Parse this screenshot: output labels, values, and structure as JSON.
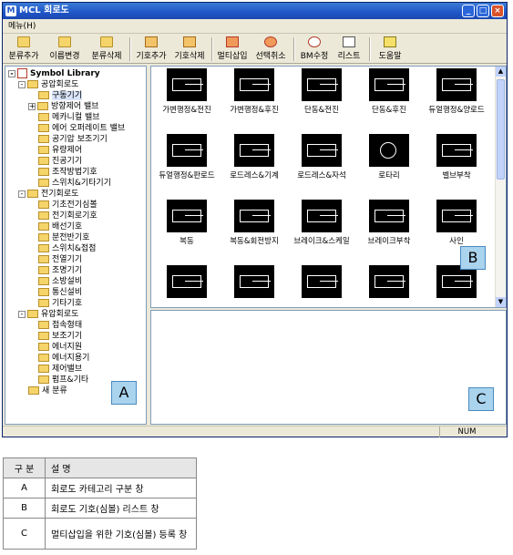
{
  "window": {
    "title": "MCL 회로도",
    "app_icon": "M",
    "controls": [
      "_",
      "□",
      "×"
    ]
  },
  "menu": {
    "label": "메뉴(H)"
  },
  "toolbar": {
    "buttons": [
      {
        "label": "분류추가",
        "icon": "folder-add-icon"
      },
      {
        "label": "이름변경",
        "icon": "folder-rename-icon"
      },
      {
        "label": "분류삭제",
        "icon": "folder-delete-icon"
      },
      {
        "label": "기호추가",
        "icon": "symbol-add-icon"
      },
      {
        "label": "기호삭제",
        "icon": "symbol-delete-icon"
      },
      {
        "label": "멀티삽입",
        "icon": "multi-insert-icon"
      },
      {
        "label": "선택취소",
        "icon": "cancel-selection-icon"
      },
      {
        "label": "BM수정",
        "icon": "bm-edit-icon"
      },
      {
        "label": "리스트",
        "icon": "list-icon"
      },
      {
        "label": "도움말",
        "icon": "help-icon"
      }
    ]
  },
  "tree": {
    "root": "Symbol Library",
    "items": [
      {
        "label": "공압회로도",
        "level": 1,
        "expander": "-"
      },
      {
        "label": "구동기기",
        "level": 2,
        "selected": true
      },
      {
        "label": "방향제어 밸브",
        "level": 2,
        "expander": "+"
      },
      {
        "label": "메카니컬 밸브",
        "level": 2
      },
      {
        "label": "에어 오퍼레이트 밸브",
        "level": 2
      },
      {
        "label": "공기압 보조기기",
        "level": 2
      },
      {
        "label": "유량제어",
        "level": 2
      },
      {
        "label": "진공기기",
        "level": 2
      },
      {
        "label": "조작방법기호",
        "level": 2
      },
      {
        "label": "스위치&기타기기",
        "level": 2
      },
      {
        "label": "전기회로도",
        "level": 1,
        "expander": "-"
      },
      {
        "label": "기초전기심볼",
        "level": 2
      },
      {
        "label": "전기회로기호",
        "level": 2
      },
      {
        "label": "배선기호",
        "level": 2
      },
      {
        "label": "분전반기호",
        "level": 2
      },
      {
        "label": "스위치&접점",
        "level": 2
      },
      {
        "label": "전열기기",
        "level": 2
      },
      {
        "label": "조명기기",
        "level": 2
      },
      {
        "label": "소방설비",
        "level": 2
      },
      {
        "label": "통신설비",
        "level": 2
      },
      {
        "label": "기타기호",
        "level": 2
      },
      {
        "label": "유압회로도",
        "level": 1,
        "expander": "-"
      },
      {
        "label": "접속형태",
        "level": 2
      },
      {
        "label": "보조기기",
        "level": 2
      },
      {
        "label": "에너지원",
        "level": 2
      },
      {
        "label": "에너지용기",
        "level": 2
      },
      {
        "label": "제어밸브",
        "level": 2
      },
      {
        "label": "펌프&기타",
        "level": 2
      },
      {
        "label": "새 분류",
        "level": 1
      }
    ]
  },
  "symbols": [
    "가변행정&전진",
    "가변행정&후진",
    "단동&전진",
    "단동&후진",
    "듀얼행정&양로드",
    "듀얼행정&판로드",
    "로드레스&기계",
    "로드레스&자석",
    "로타리",
    "벨브부착",
    "복동",
    "복동&회전방지",
    "브레이크&스케일",
    "브레이크부착",
    "사인",
    "",
    "",
    "",
    "",
    ""
  ],
  "status": {
    "num": "NUM"
  },
  "callouts": {
    "a": "A",
    "b": "B",
    "c": "C"
  },
  "legend": {
    "headers": [
      "구 분",
      "설 명"
    ],
    "rows": [
      [
        "A",
        "회로도 카테고리 구분 창"
      ],
      [
        "B",
        "회로도 기호(심볼) 리스트 창"
      ],
      [
        "C",
        "멀티삽입을 위한 기호(심볼) 등록 창"
      ]
    ]
  }
}
